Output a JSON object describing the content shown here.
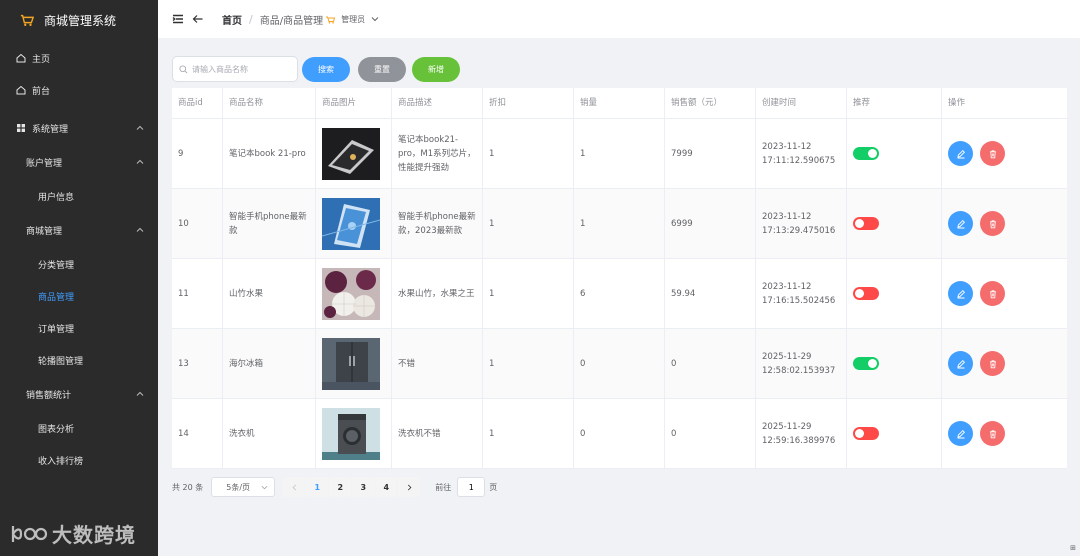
{
  "app": {
    "title": "商城管理系统"
  },
  "sidebar": {
    "items": [
      {
        "label": "主页"
      },
      {
        "label": "前台"
      },
      {
        "label": "系统管理"
      },
      {
        "label": "账户管理"
      },
      {
        "label": "用户信息"
      },
      {
        "label": "商城管理"
      },
      {
        "label": "分类管理"
      },
      {
        "label": "商品管理"
      },
      {
        "label": "订单管理"
      },
      {
        "label": "轮播图管理"
      },
      {
        "label": "销售额统计"
      },
      {
        "label": "图表分析"
      },
      {
        "label": "收入排行榜"
      }
    ],
    "active": "商品管理"
  },
  "watermark": {
    "text": "大数跨境"
  },
  "header": {
    "breadcrumb_home": "首页",
    "breadcrumb_sep": "/",
    "breadcrumb_current": "商品/商品管理",
    "user_name": "管理员"
  },
  "toolbar": {
    "search_placeholder": "请输入商品名称",
    "search_button": "搜索",
    "reset_button": "重置",
    "add_button": "新增"
  },
  "table": {
    "columns": [
      "商品id",
      "商品名称",
      "商品图片",
      "商品描述",
      "折扣",
      "销量",
      "销售额（元）",
      "创建时间",
      "推荐",
      "操作"
    ],
    "rows": [
      {
        "id": "9",
        "name": "笔记本book 21-pro",
        "image": "laptop",
        "desc": "笔记本book21-pro，M1系列芯片，性能提升强劲",
        "discount": "1",
        "sales": "1",
        "revenue": "7999",
        "created": "2023-11-12 17:11:12.590675",
        "recommend": true
      },
      {
        "id": "10",
        "name": "智能手机phone最新款",
        "image": "smartphone",
        "desc": "智能手机phone最新款，2023最新款",
        "discount": "1",
        "sales": "1",
        "revenue": "6999",
        "created": "2023-11-12 17:13:29.475016",
        "recommend": false
      },
      {
        "id": "11",
        "name": "山竹水果",
        "image": "mangosteen",
        "desc": "水果山竹，水果之王",
        "discount": "1",
        "sales": "6",
        "revenue": "59.94",
        "created": "2023-11-12 17:16:15.502456",
        "recommend": false
      },
      {
        "id": "13",
        "name": "海尔冰箱",
        "image": "refrigerator",
        "desc": "不错",
        "discount": "1",
        "sales": "0",
        "revenue": "0",
        "created": "2025-11-29 12:58:02.153937",
        "recommend": true
      },
      {
        "id": "14",
        "name": "洗衣机",
        "image": "washing-machine",
        "desc": "洗衣机不错",
        "discount": "1",
        "sales": "0",
        "revenue": "0",
        "created": "2025-11-29 12:59:16.389976",
        "recommend": false
      }
    ]
  },
  "pagination": {
    "total_label": "共 20 条",
    "page_size": "5条/页",
    "pages": [
      "1",
      "2",
      "3",
      "4"
    ],
    "current": "1",
    "goto_label": "前往",
    "goto_value": "1",
    "page_unit": "页"
  },
  "colors": {
    "primary": "#409eff",
    "success": "#67c23a",
    "info": "#909399",
    "danger": "#f56c6c",
    "sidebar_bg": "#2b2b2b",
    "switch_on": "#13ce66",
    "switch_off": "#ff4949"
  }
}
